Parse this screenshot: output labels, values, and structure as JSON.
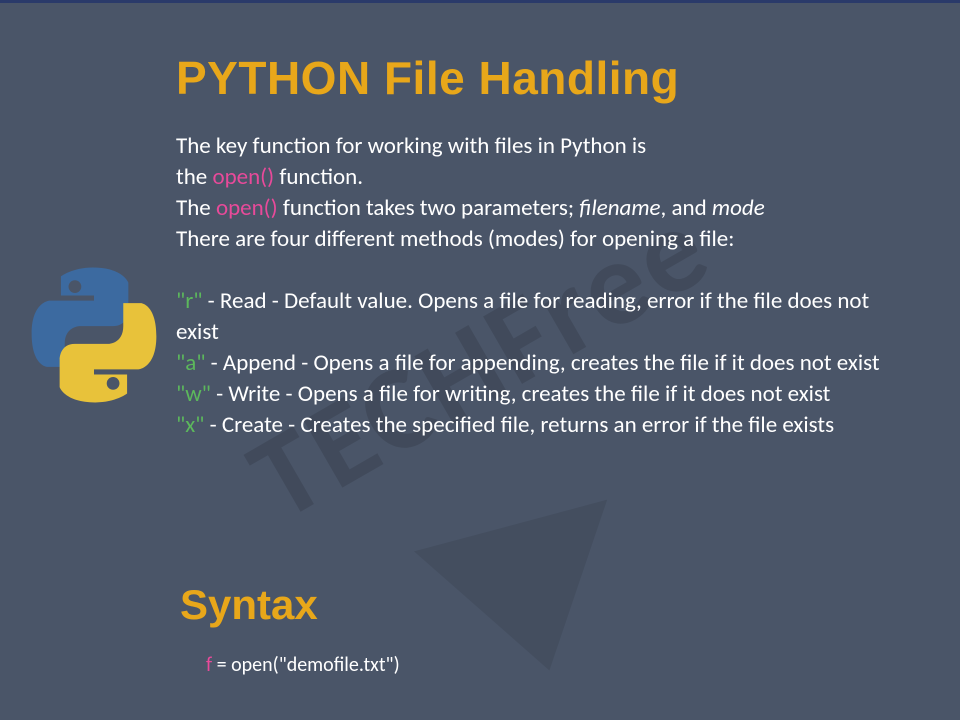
{
  "title": "PYTHON File Handling",
  "intro": {
    "line1_a": "The key function for working with files in Python is",
    "line1_b": "the ",
    "open_fn": " open() ",
    "line1_c": " function.",
    "line2_a": "The ",
    "open_fn2": "open()",
    "line2_b": " function takes two parameters; ",
    "filename": "filename",
    "sep": ", and ",
    "mode": "mode",
    "line3": "There are four different methods (modes) for opening a file:"
  },
  "modes": {
    "r_key": "\"r\"",
    "r_text": " - Read - Default value. Opens a file for reading, error if the file does not exist",
    "a_key": "\"a\"",
    "a_text": " - Append - Opens a file for appending, creates the file if it does not exist",
    "w_key": "\"w\"",
    "w_text": " - Write - Opens a file for writing, creates the file if it does not exist",
    "x_key": "\"x\"",
    "x_text": " - Create - Creates the specified file, returns an error if the file exists"
  },
  "syntax_heading": "Syntax",
  "code": {
    "var": "f",
    "rest": " = open(\"demofile.txt\")"
  },
  "watermark": "TECHFree"
}
